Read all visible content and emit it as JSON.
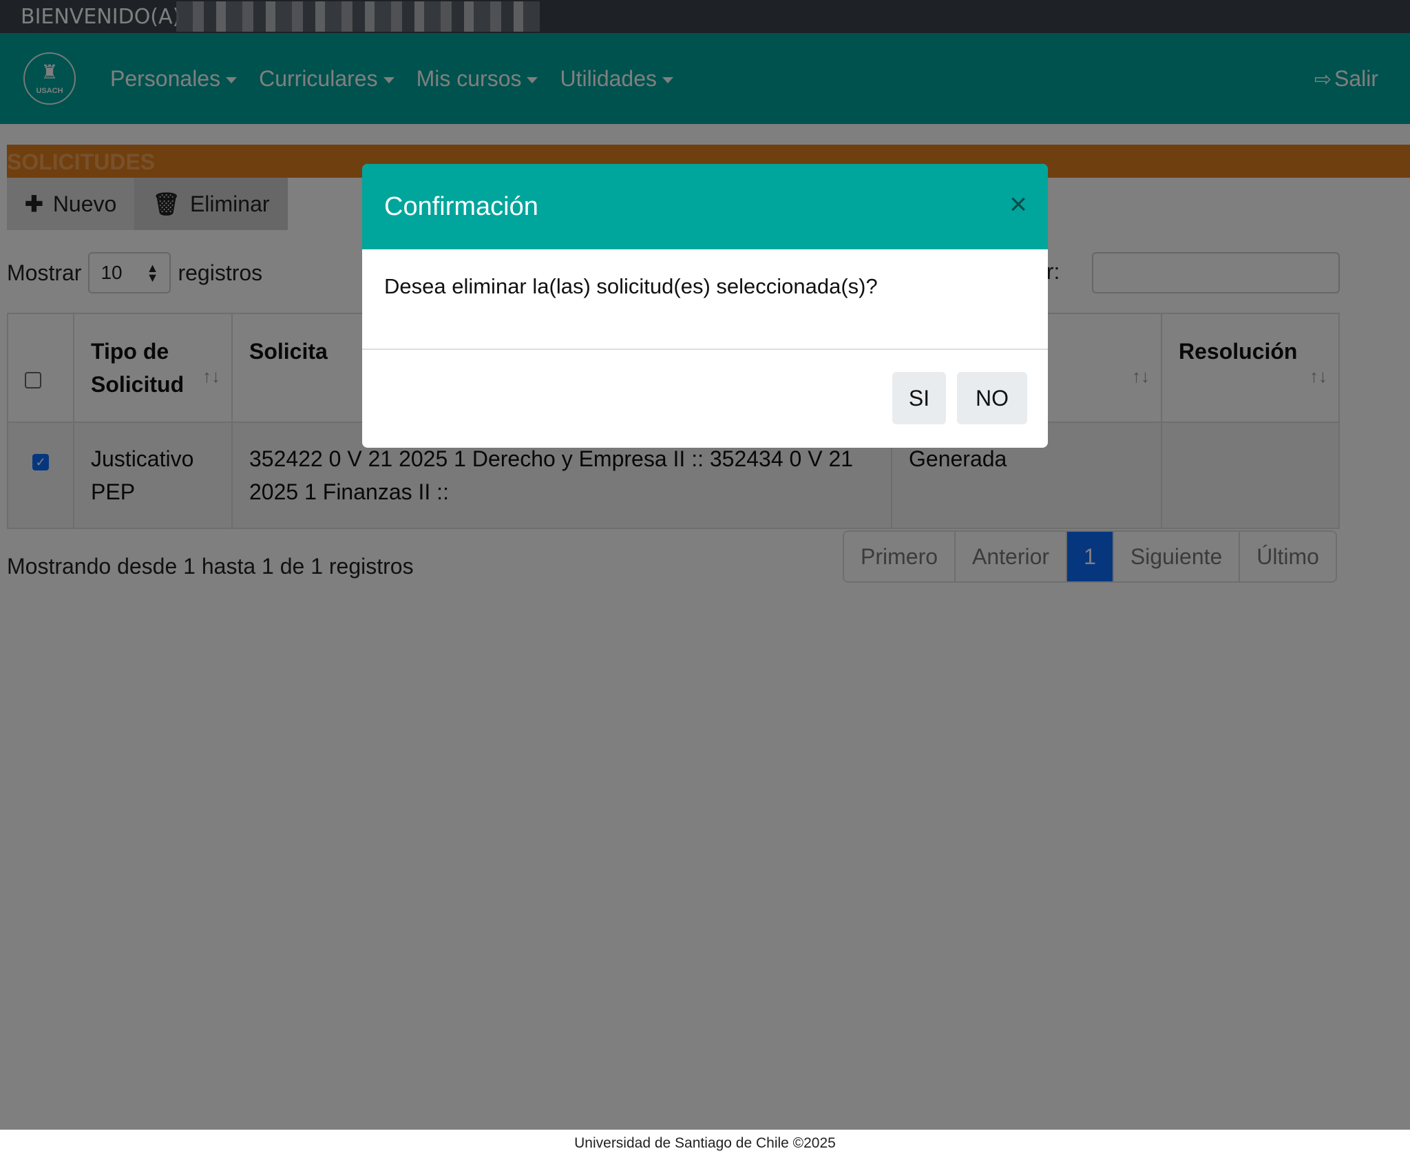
{
  "welcome": {
    "label": "BIENVENIDO(A)"
  },
  "nav": {
    "logo_text": "USACH",
    "items": [
      {
        "label": "Personales"
      },
      {
        "label": "Curriculares"
      },
      {
        "label": "Mis cursos"
      },
      {
        "label": "Utilidades"
      }
    ],
    "logout_label": "Salir"
  },
  "section": {
    "title": "SOLICITUDES"
  },
  "toolbar": {
    "new_label": "Nuevo",
    "delete_label": "Eliminar"
  },
  "length": {
    "show_label": "Mostrar",
    "value": "10",
    "records_label": "registros"
  },
  "search": {
    "label": "car:"
  },
  "table": {
    "headers": {
      "type": "Tipo de Solicitud",
      "request": "Solicita",
      "state": "",
      "resolution": "Resolución"
    },
    "rows": [
      {
        "checked": true,
        "type": "Justicativo PEP",
        "request": "352422 0 V 21 2025 1 Derecho y Empresa II :: 352434 0 V 21 2025 1 Finanzas II ::",
        "state": "Generada",
        "resolution": ""
      }
    ]
  },
  "info_text": "Mostrando desde 1 hasta 1 de 1 registros",
  "pagination": {
    "first": "Primero",
    "previous": "Anterior",
    "current": "1",
    "next": "Siguiente",
    "last": "Último"
  },
  "footer": {
    "text": "Universidad de Santiago de Chile ©2025"
  },
  "modal": {
    "title": "Confirmación",
    "message": "Desea eliminar la(las) solicitud(es) seleccionada(s)?",
    "yes_label": "SI",
    "no_label": "NO"
  },
  "colors": {
    "nav": "#00a59c",
    "section": "#e07f1f",
    "active_page": "#0d6efd"
  }
}
